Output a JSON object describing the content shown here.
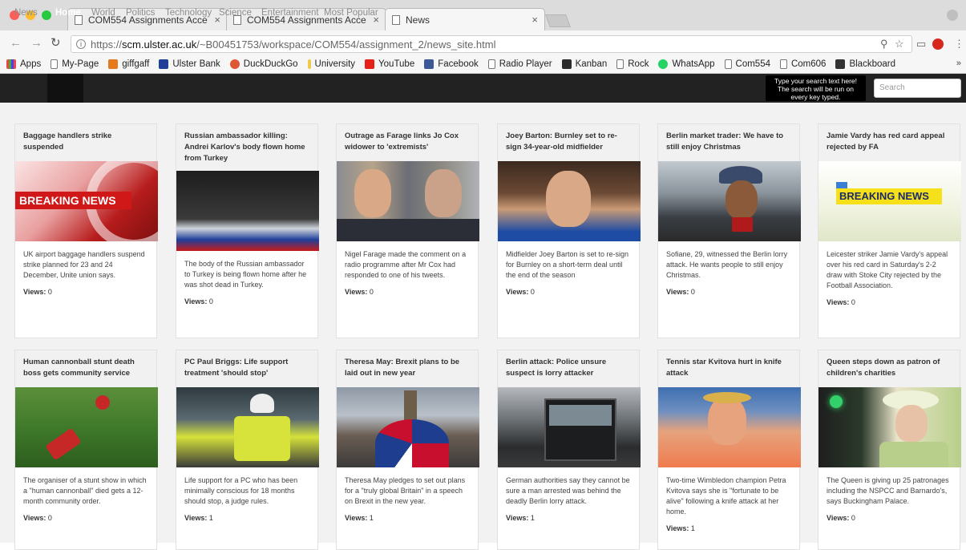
{
  "browser": {
    "tabs": [
      {
        "title": "COM554 Assignments Acce"
      },
      {
        "title": "COM554 Assignments Acce"
      },
      {
        "title": "News"
      }
    ],
    "url_scheme": "https://",
    "url_host": "scm.ulster.ac.uk",
    "url_path": "/~B00451753/workspace/COM554/assignment_2/news_site.html",
    "bookmarks": [
      "Apps",
      "My-Page",
      "giffgaff",
      "Ulster Bank",
      "DuckDuckGo",
      "University",
      "YouTube",
      "Facebook",
      "Radio Player",
      "Kanban",
      "Rock",
      "WhatsApp",
      "Com554",
      "Com606",
      "Blackboard"
    ],
    "bookmarks_more": "»"
  },
  "site_nav": {
    "brand": "News",
    "items": [
      "Home",
      "World",
      "Politics",
      "Technology",
      "Science",
      "Entertainment",
      "Most Popular"
    ],
    "active": "Home",
    "tooltip": "Type your search text here! The search will be run on every key typed.",
    "search_placeholder": "Search"
  },
  "articles": [
    {
      "title": "Baggage handlers strike suspended",
      "summary": "UK airport baggage handlers suspend strike planned for 23 and 24 December, Unite union says.",
      "views_label": "Views:",
      "views": "0",
      "image": "breaking-news-red",
      "image_text": "BREAKING NEWS"
    },
    {
      "title": "Russian ambassador killing: Andrei Karlov's body flown home from Turkey",
      "summary": "The body of the Russian ambassador to Turkey is being flown home after he was shot dead in Turkey.",
      "views_label": "Views:",
      "views": "0",
      "image": "flag-draped-coffin"
    },
    {
      "title": "Outrage as Farage links Jo Cox widower to 'extremists'",
      "summary": "Nigel Farage made the comment on a radio programme after Mr Cox had responded to one of his tweets.",
      "views_label": "Views:",
      "views": "0",
      "image": "two-men-portraits"
    },
    {
      "title": "Joey Barton: Burnley set to re-sign 34-year-old midfielder",
      "summary": "Midfielder Joey Barton is set to re-sign for Burnley on a short-term deal until the end of the season",
      "views_label": "Views:",
      "views": "0",
      "image": "footballer-portrait"
    },
    {
      "title": "Berlin market trader: We have to still enjoy Christmas",
      "summary": "Sofiane, 29, witnessed the Berlin lorry attack. He wants people to still enjoy Christmas.",
      "views_label": "Views:",
      "views": "0",
      "image": "market-trader"
    },
    {
      "title": "Jamie Vardy has red card appeal rejected by FA",
      "summary": "Leicester striker Jamie Vardy's appeal over his red card in Saturday's 2-2 draw with Stoke City rejected by the Football Association.",
      "views_label": "Views:",
      "views": "0",
      "image": "breaking-news-yellow",
      "image_text": "BREAKING NEWS"
    },
    {
      "title": "Human cannonball stunt death boss gets community service",
      "summary": "The organiser of a stunt show in which a \"human cannonball\" died gets a 12-month community order.",
      "views_label": "Views:",
      "views": "0",
      "image": "human-cannonball"
    },
    {
      "title": "PC Paul Briggs: Life support treatment 'should stop'",
      "summary": "Life support for a PC who has been minimally conscious for 18 months should stop, a judge rules.",
      "views_label": "Views:",
      "views": "1",
      "image": "police-officer"
    },
    {
      "title": "Theresa May: Brexit plans to be laid out in new year",
      "summary": "Theresa May pledges to set out plans for a \"truly global Britain\" in a speech on Brexit in the new year.",
      "views_label": "Views:",
      "views": "1",
      "image": "big-ben-union-jack-umbrella"
    },
    {
      "title": "Berlin attack: Police unsure suspect is lorry attacker",
      "summary": "German authorities say they cannot be sure a man arrested was behind the deadly Berlin lorry attack.",
      "views_label": "Views:",
      "views": "1",
      "image": "lorry-at-market"
    },
    {
      "title": "Tennis star Kvitova hurt in knife attack",
      "summary": "Two-time Wimbledon champion Petra Kvitova says she is \"fortunate to be alive\" following a knife attack at her home.",
      "views_label": "Views:",
      "views": "1",
      "image": "tennis-player"
    },
    {
      "title": "Queen steps down as patron of children's charities",
      "summary": "The Queen is giving up 25 patronages including the NSPCC and Barnardo's, says Buckingham Palace.",
      "views_label": "Views:",
      "views": "0",
      "image": "queen"
    }
  ],
  "colors": {
    "nav_bg": "#222222",
    "grid_bg": "#f2f2f2",
    "breaking_red": "#d01818",
    "breaking_yellow": "#f5e01a"
  }
}
